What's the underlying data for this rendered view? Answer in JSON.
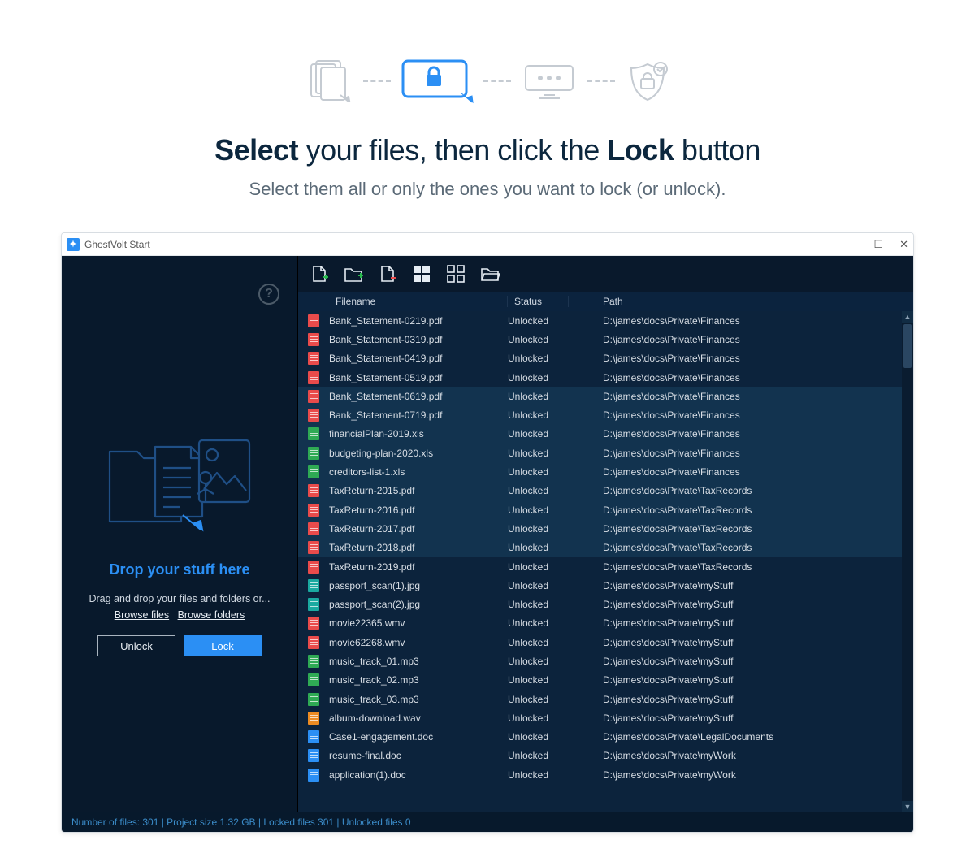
{
  "hero": {
    "headline_b1": "Select",
    "headline_mid": " your files, then click the ",
    "headline_b2": "Lock",
    "headline_end": " button",
    "subline": "Select them all or only the ones you want to lock (or unlock)."
  },
  "window": {
    "title": "GhostVolt Start"
  },
  "sidebar": {
    "drop_title": "Drop your stuff here",
    "drop_caption": "Drag and drop your files and folders or...",
    "browse_files": "Browse files",
    "browse_folders": "Browse folders",
    "unlock_label": "Unlock",
    "lock_label": "Lock"
  },
  "columns": {
    "filename": "Filename",
    "status": "Status",
    "path": "Path"
  },
  "files": [
    {
      "name": "Bank_Statement-0219.pdf",
      "status": "Unlocked",
      "path": "D:\\james\\docs\\Private\\Finances",
      "icon": "red",
      "sel": false
    },
    {
      "name": "Bank_Statement-0319.pdf",
      "status": "Unlocked",
      "path": "D:\\james\\docs\\Private\\Finances",
      "icon": "red",
      "sel": false
    },
    {
      "name": "Bank_Statement-0419.pdf",
      "status": "Unlocked",
      "path": "D:\\james\\docs\\Private\\Finances",
      "icon": "red",
      "sel": false
    },
    {
      "name": "Bank_Statement-0519.pdf",
      "status": "Unlocked",
      "path": "D:\\james\\docs\\Private\\Finances",
      "icon": "red",
      "sel": false
    },
    {
      "name": "Bank_Statement-0619.pdf",
      "status": "Unlocked",
      "path": "D:\\james\\docs\\Private\\Finances",
      "icon": "red",
      "sel": true
    },
    {
      "name": "Bank_Statement-0719.pdf",
      "status": "Unlocked",
      "path": "D:\\james\\docs\\Private\\Finances",
      "icon": "red",
      "sel": true
    },
    {
      "name": "financialPlan-2019.xls",
      "status": "Unlocked",
      "path": "D:\\james\\docs\\Private\\Finances",
      "icon": "green",
      "sel": true
    },
    {
      "name": "budgeting-plan-2020.xls",
      "status": "Unlocked",
      "path": "D:\\james\\docs\\Private\\Finances",
      "icon": "green",
      "sel": true
    },
    {
      "name": "creditors-list-1.xls",
      "status": "Unlocked",
      "path": "D:\\james\\docs\\Private\\Finances",
      "icon": "green",
      "sel": true
    },
    {
      "name": "TaxReturn-2015.pdf",
      "status": "Unlocked",
      "path": "D:\\james\\docs\\Private\\TaxRecords",
      "icon": "red",
      "sel": true
    },
    {
      "name": "TaxReturn-2016.pdf",
      "status": "Unlocked",
      "path": "D:\\james\\docs\\Private\\TaxRecords",
      "icon": "red",
      "sel": true
    },
    {
      "name": "TaxReturn-2017.pdf",
      "status": "Unlocked",
      "path": "D:\\james\\docs\\Private\\TaxRecords",
      "icon": "red",
      "sel": true
    },
    {
      "name": "TaxReturn-2018.pdf",
      "status": "Unlocked",
      "path": "D:\\james\\docs\\Private\\TaxRecords",
      "icon": "red",
      "sel": true
    },
    {
      "name": "TaxReturn-2019.pdf",
      "status": "Unlocked",
      "path": "D:\\james\\docs\\Private\\TaxRecords",
      "icon": "red",
      "sel": false
    },
    {
      "name": "passport_scan(1).jpg",
      "status": "Unlocked",
      "path": "D:\\james\\docs\\Private\\myStuff",
      "icon": "teal",
      "sel": false
    },
    {
      "name": "passport_scan(2).jpg",
      "status": "Unlocked",
      "path": "D:\\james\\docs\\Private\\myStuff",
      "icon": "teal",
      "sel": false
    },
    {
      "name": "movie22365.wmv",
      "status": "Unlocked",
      "path": "D:\\james\\docs\\Private\\myStuff",
      "icon": "red",
      "sel": false
    },
    {
      "name": "movie62268.wmv",
      "status": "Unlocked",
      "path": "D:\\james\\docs\\Private\\myStuff",
      "icon": "red",
      "sel": false
    },
    {
      "name": "music_track_01.mp3",
      "status": "Unlocked",
      "path": "D:\\james\\docs\\Private\\myStuff",
      "icon": "green",
      "sel": false
    },
    {
      "name": "music_track_02.mp3",
      "status": "Unlocked",
      "path": "D:\\james\\docs\\Private\\myStuff",
      "icon": "green",
      "sel": false
    },
    {
      "name": "music_track_03.mp3",
      "status": "Unlocked",
      "path": "D:\\james\\docs\\Private\\myStuff",
      "icon": "green",
      "sel": false
    },
    {
      "name": "album-download.wav",
      "status": "Unlocked",
      "path": "D:\\james\\docs\\Private\\myStuff",
      "icon": "orange",
      "sel": false
    },
    {
      "name": "Case1-engagement.doc",
      "status": "Unlocked",
      "path": "D:\\james\\docs\\Private\\LegalDocuments",
      "icon": "blue",
      "sel": false
    },
    {
      "name": "resume-final.doc",
      "status": "Unlocked",
      "path": "D:\\james\\docs\\Private\\myWork",
      "icon": "blue",
      "sel": false
    },
    {
      "name": "application(1).doc",
      "status": "Unlocked",
      "path": "D:\\james\\docs\\Private\\myWork",
      "icon": "blue",
      "sel": false
    }
  ],
  "statusbar": {
    "text": "Number of files: 301 | Project size 1.32 GB | Locked files 301 | Unlocked files 0"
  }
}
